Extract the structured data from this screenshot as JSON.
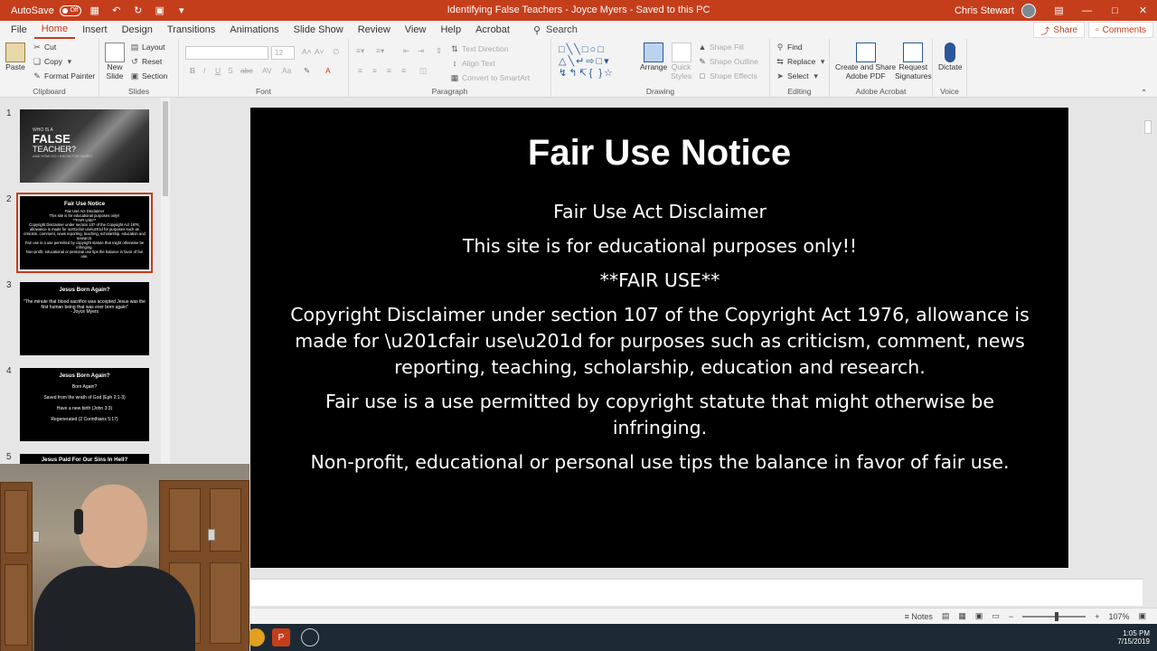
{
  "titlebar": {
    "autosave_label": "AutoSave",
    "autosave_state": "Off",
    "doc_title": "Identifying False Teachers - Joyce Myers  -  Saved to this PC",
    "user_name": "Chris Stewart",
    "bg_color": "#c43e1c"
  },
  "menu": {
    "tabs": [
      "File",
      "Home",
      "Insert",
      "Design",
      "Transitions",
      "Animations",
      "Slide Show",
      "Review",
      "View",
      "Help",
      "Acrobat"
    ],
    "active_tab": "Home",
    "search_label": "Search",
    "share_label": "Share",
    "comments_label": "Comments"
  },
  "ribbon": {
    "clipboard": {
      "label": "Clipboard",
      "paste": "Paste",
      "cut": "Cut",
      "copy": "Copy",
      "format_painter": "Format Painter"
    },
    "slides": {
      "label": "Slides",
      "new_slide_1": "New",
      "new_slide_2": "Slide",
      "layout": "Layout",
      "reset": "Reset",
      "section": "Section"
    },
    "font": {
      "label": "Font",
      "size": "12"
    },
    "paragraph": {
      "label": "Paragraph",
      "text_direction": "Text Direction",
      "align_text": "Align Text",
      "smartart": "Convert to SmartArt"
    },
    "drawing": {
      "label": "Drawing",
      "arrange": "Arrange",
      "quick_styles_1": "Quick",
      "quick_styles_2": "Styles",
      "shape_fill": "Shape Fill",
      "shape_outline": "Shape Outline",
      "shape_effects": "Shape Effects"
    },
    "editing": {
      "label": "Editing",
      "find": "Find",
      "replace": "Replace",
      "select": "Select"
    },
    "acrobat": {
      "label": "Adobe Acrobat",
      "create_1": "Create and Share",
      "create_2": "Adobe PDF",
      "request_1": "Request",
      "request_2": "Signatures"
    },
    "voice": {
      "label": "Voice",
      "dictate": "Dictate"
    }
  },
  "thumbnails": [
    {
      "num": "1",
      "line_a": "WHO IS A",
      "line_b": "FALSE",
      "line_c": "TEACHER?",
      "line_d": "AND HOW DO I KNOW FOR SURE?"
    },
    {
      "num": "2",
      "title": "Fair Use Notice",
      "lines": [
        "Fair Use Act Disclaimer",
        "This site is for educational purposes only!!",
        "**FAIR USE**",
        "Copyright Disclaimer under section 107 of the Copyright Act 1976, allowance is made for \\u201cfair use\\u201d for purposes such as criticism, comment, news reporting, teaching, scholarship, education and research.",
        "Fair use is a use permitted by copyright statute that might otherwise be infringing.",
        "Non-profit, educational or personal use tips the balance in favor of fair use."
      ]
    },
    {
      "num": "3",
      "title": "Jesus Born Again?",
      "lines": [
        "\"The minute that blood sacrifice was accepted Jesus was the first human being that was ever born again\"",
        "- Joyce Myers"
      ]
    },
    {
      "num": "4",
      "title": "Jesus Born Again?",
      "lines": [
        "Born Again?",
        "Saved from the wrath of God (Eph 2:1-3)",
        "Have a new birth (John 3:3)",
        "Regenerated (2 Corinthians 5:17)"
      ]
    },
    {
      "num": "5",
      "title": "Jesus Paid For Our Sins In Hell?"
    }
  ],
  "slide": {
    "title": "Fair Use Notice",
    "paragraphs": [
      "Fair Use Act Disclaimer",
      "This site is for educational purposes only!!",
      "**FAIR USE**",
      "Copyright Disclaimer under section 107 of the Copyright Act 1976, allowance is made for \\u201cfair use\\u201d for purposes such as criticism, comment, news reporting, teaching, scholarship, education and research.",
      "Fair use is a use permitted by copyright statute that might otherwise be infringing.",
      "Non-profit, educational or personal use tips the balance in favor of fair use."
    ]
  },
  "statusbar": {
    "notes": "Notes",
    "zoom": "107%"
  },
  "taskbar": {
    "time": "1:05 PM",
    "date": "7/15/2019"
  }
}
